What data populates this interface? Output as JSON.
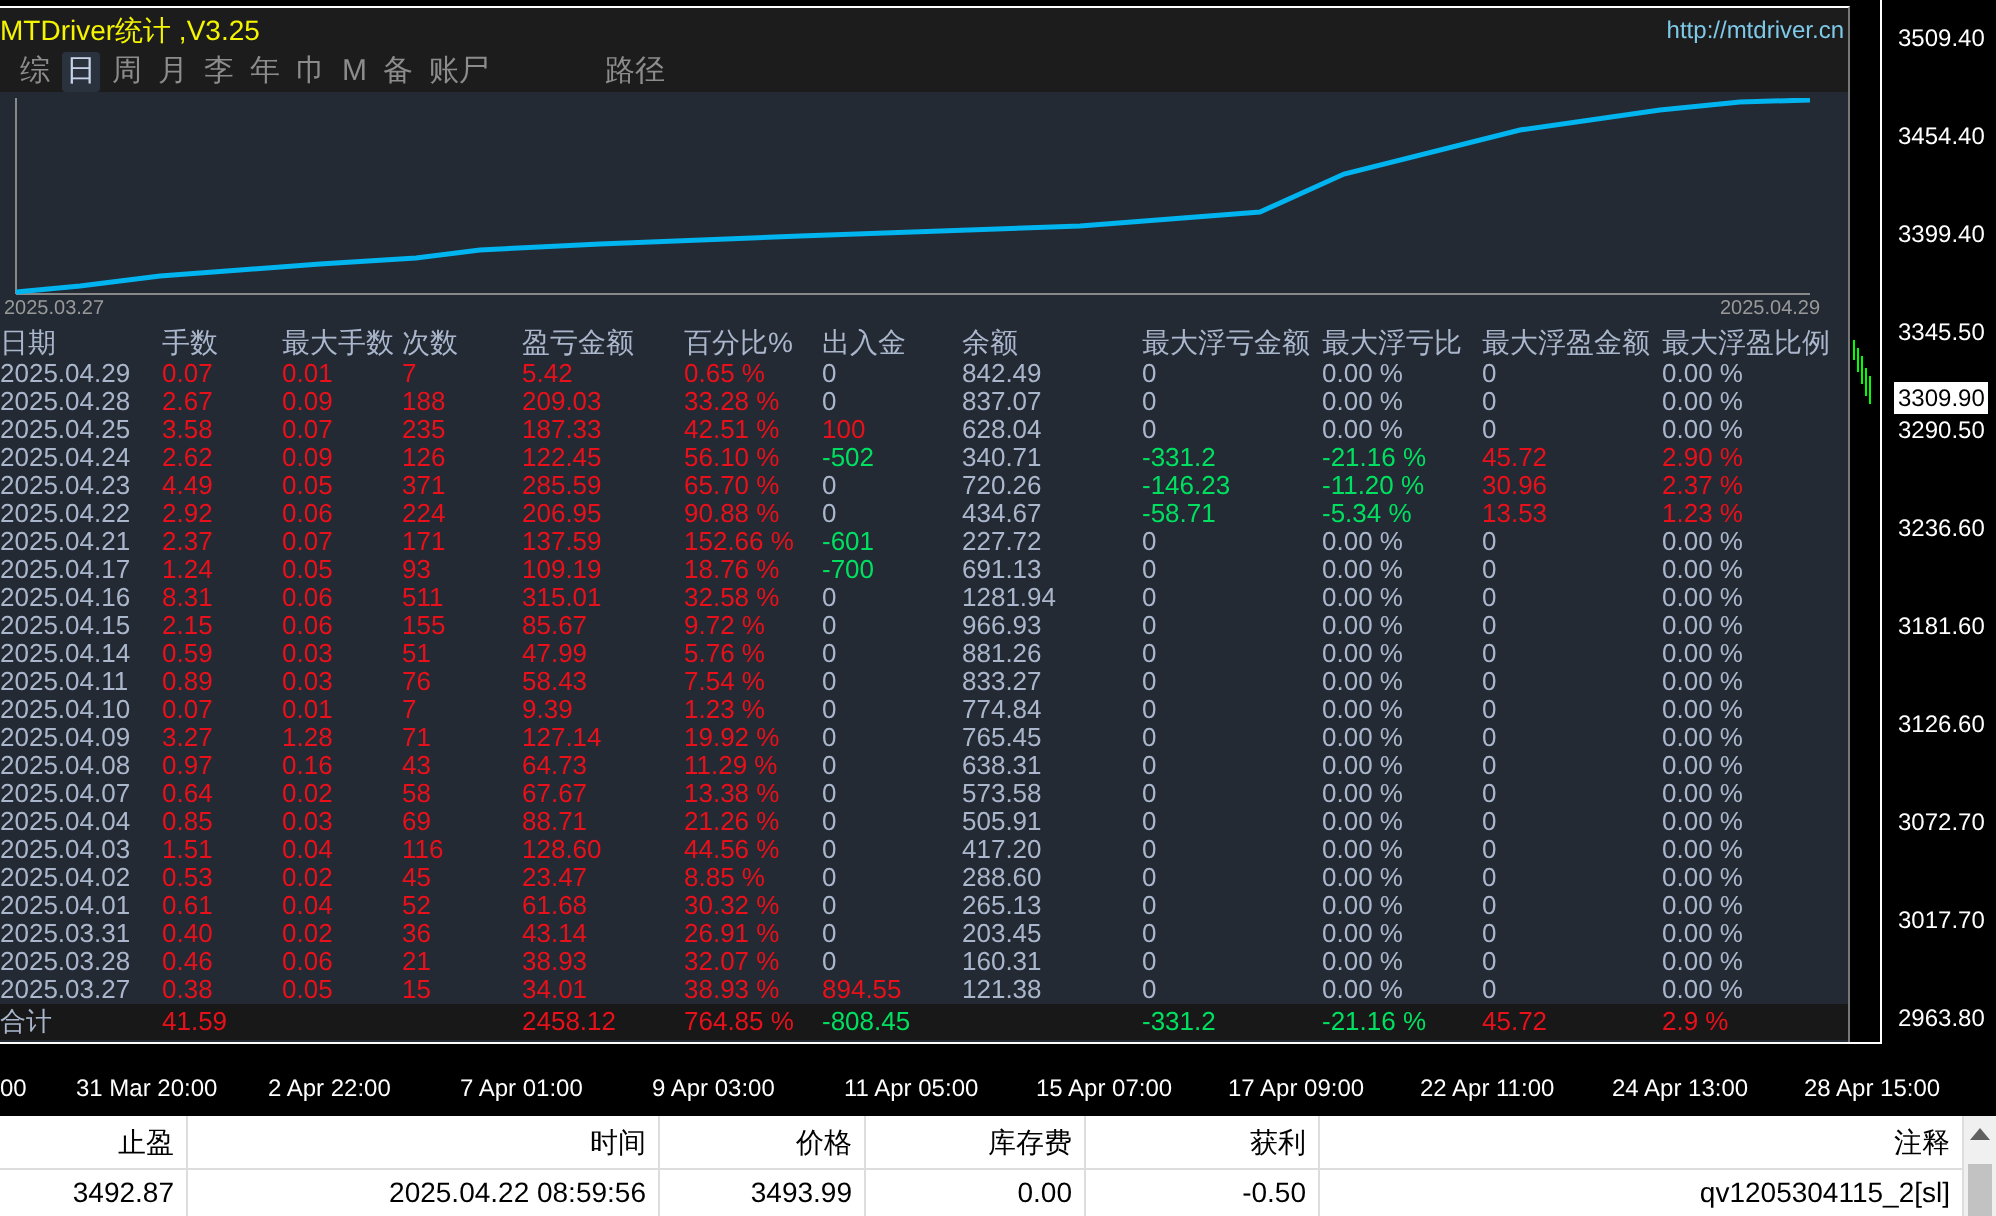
{
  "panel": {
    "title": "MTDriver统计 ,V3.25",
    "url": "http://mtdriver.cn",
    "tabs": [
      {
        "label": "综",
        "selected": false
      },
      {
        "label": "日",
        "selected": true
      },
      {
        "label": "周",
        "selected": false
      },
      {
        "label": "月",
        "selected": false
      },
      {
        "label": "李",
        "selected": false
      },
      {
        "label": "年",
        "selected": false
      },
      {
        "label": "巾",
        "selected": false
      },
      {
        "label": "M",
        "selected": false
      },
      {
        "label": "备",
        "selected": false
      },
      {
        "label": "账尸",
        "selected": false
      }
    ],
    "path_tab": "路径",
    "equity_chart": {
      "start_label": "2025.03.27",
      "end_label": "2025.04.29"
    },
    "table": {
      "columns": [
        "日期",
        "手数",
        "最大手数",
        "次数",
        "盈亏金额",
        "百分比%",
        "出入金",
        "余额",
        "最大浮亏金额",
        "最大浮亏比",
        "最大浮盈金额",
        "最大浮盈比例"
      ],
      "rows": [
        [
          {
            "text": "2025.04.29",
            "color": "#aab6cc"
          },
          {
            "text": "0.07",
            "color": "#e8101a"
          },
          {
            "text": "0.01",
            "color": "#e8101a"
          },
          {
            "text": "7",
            "color": "#e8101a"
          },
          {
            "text": "5.42",
            "color": "#e8101a"
          },
          {
            "text": "0.65 %",
            "color": "#e8101a"
          },
          {
            "text": "0",
            "color": "#aab6cc"
          },
          {
            "text": "842.49",
            "color": "#aab6cc"
          },
          {
            "text": "0",
            "color": "#aab6cc"
          },
          {
            "text": "0.00 %",
            "color": "#aab6cc"
          },
          {
            "text": "0",
            "color": "#aab6cc"
          },
          {
            "text": "0.00 %",
            "color": "#aab6cc"
          }
        ],
        [
          {
            "text": "2025.04.28",
            "color": "#aab6cc"
          },
          {
            "text": "2.67",
            "color": "#e8101a"
          },
          {
            "text": "0.09",
            "color": "#e8101a"
          },
          {
            "text": "188",
            "color": "#e8101a"
          },
          {
            "text": "209.03",
            "color": "#e8101a"
          },
          {
            "text": "33.28 %",
            "color": "#e8101a"
          },
          {
            "text": "0",
            "color": "#aab6cc"
          },
          {
            "text": "837.07",
            "color": "#aab6cc"
          },
          {
            "text": "0",
            "color": "#aab6cc"
          },
          {
            "text": "0.00 %",
            "color": "#aab6cc"
          },
          {
            "text": "0",
            "color": "#aab6cc"
          },
          {
            "text": "0.00 %",
            "color": "#aab6cc"
          }
        ],
        [
          {
            "text": "2025.04.25",
            "color": "#aab6cc"
          },
          {
            "text": "3.58",
            "color": "#e8101a"
          },
          {
            "text": "0.07",
            "color": "#e8101a"
          },
          {
            "text": "235",
            "color": "#e8101a"
          },
          {
            "text": "187.33",
            "color": "#e8101a"
          },
          {
            "text": "42.51 %",
            "color": "#e8101a"
          },
          {
            "text": "100",
            "color": "#e8101a"
          },
          {
            "text": "628.04",
            "color": "#aab6cc"
          },
          {
            "text": "0",
            "color": "#aab6cc"
          },
          {
            "text": "0.00 %",
            "color": "#aab6cc"
          },
          {
            "text": "0",
            "color": "#aab6cc"
          },
          {
            "text": "0.00 %",
            "color": "#aab6cc"
          }
        ],
        [
          {
            "text": "2025.04.24",
            "color": "#aab6cc"
          },
          {
            "text": "2.62",
            "color": "#e8101a"
          },
          {
            "text": "0.09",
            "color": "#e8101a"
          },
          {
            "text": "126",
            "color": "#e8101a"
          },
          {
            "text": "122.45",
            "color": "#e8101a"
          },
          {
            "text": "56.10 %",
            "color": "#e8101a"
          },
          {
            "text": "-502",
            "color": "#00e060"
          },
          {
            "text": "340.71",
            "color": "#aab6cc"
          },
          {
            "text": "-331.2",
            "color": "#00e060"
          },
          {
            "text": "-21.16 %",
            "color": "#00e060"
          },
          {
            "text": "45.72",
            "color": "#e8101a"
          },
          {
            "text": "2.90 %",
            "color": "#e8101a"
          }
        ],
        [
          {
            "text": "2025.04.23",
            "color": "#aab6cc"
          },
          {
            "text": "4.49",
            "color": "#e8101a"
          },
          {
            "text": "0.05",
            "color": "#e8101a"
          },
          {
            "text": "371",
            "color": "#e8101a"
          },
          {
            "text": "285.59",
            "color": "#e8101a"
          },
          {
            "text": "65.70 %",
            "color": "#e8101a"
          },
          {
            "text": "0",
            "color": "#aab6cc"
          },
          {
            "text": "720.26",
            "color": "#aab6cc"
          },
          {
            "text": "-146.23",
            "color": "#00e060"
          },
          {
            "text": "-11.20 %",
            "color": "#00e060"
          },
          {
            "text": "30.96",
            "color": "#e8101a"
          },
          {
            "text": "2.37 %",
            "color": "#e8101a"
          }
        ],
        [
          {
            "text": "2025.04.22",
            "color": "#aab6cc"
          },
          {
            "text": "2.92",
            "color": "#e8101a"
          },
          {
            "text": "0.06",
            "color": "#e8101a"
          },
          {
            "text": "224",
            "color": "#e8101a"
          },
          {
            "text": "206.95",
            "color": "#e8101a"
          },
          {
            "text": "90.88 %",
            "color": "#e8101a"
          },
          {
            "text": "0",
            "color": "#aab6cc"
          },
          {
            "text": "434.67",
            "color": "#aab6cc"
          },
          {
            "text": "-58.71",
            "color": "#00e060"
          },
          {
            "text": "-5.34 %",
            "color": "#00e060"
          },
          {
            "text": "13.53",
            "color": "#e8101a"
          },
          {
            "text": "1.23 %",
            "color": "#e8101a"
          }
        ],
        [
          {
            "text": "2025.04.21",
            "color": "#aab6cc"
          },
          {
            "text": "2.37",
            "color": "#e8101a"
          },
          {
            "text": "0.07",
            "color": "#e8101a"
          },
          {
            "text": "171",
            "color": "#e8101a"
          },
          {
            "text": "137.59",
            "color": "#e8101a"
          },
          {
            "text": "152.66 %",
            "color": "#e8101a"
          },
          {
            "text": "-601",
            "color": "#00e060"
          },
          {
            "text": "227.72",
            "color": "#aab6cc"
          },
          {
            "text": "0",
            "color": "#aab6cc"
          },
          {
            "text": "0.00 %",
            "color": "#aab6cc"
          },
          {
            "text": "0",
            "color": "#aab6cc"
          },
          {
            "text": "0.00 %",
            "color": "#aab6cc"
          }
        ],
        [
          {
            "text": "2025.04.17",
            "color": "#aab6cc"
          },
          {
            "text": "1.24",
            "color": "#e8101a"
          },
          {
            "text": "0.05",
            "color": "#e8101a"
          },
          {
            "text": "93",
            "color": "#e8101a"
          },
          {
            "text": "109.19",
            "color": "#e8101a"
          },
          {
            "text": "18.76 %",
            "color": "#e8101a"
          },
          {
            "text": "-700",
            "color": "#00e060"
          },
          {
            "text": "691.13",
            "color": "#aab6cc"
          },
          {
            "text": "0",
            "color": "#aab6cc"
          },
          {
            "text": "0.00 %",
            "color": "#aab6cc"
          },
          {
            "text": "0",
            "color": "#aab6cc"
          },
          {
            "text": "0.00 %",
            "color": "#aab6cc"
          }
        ],
        [
          {
            "text": "2025.04.16",
            "color": "#aab6cc"
          },
          {
            "text": "8.31",
            "color": "#e8101a"
          },
          {
            "text": "0.06",
            "color": "#e8101a"
          },
          {
            "text": "511",
            "color": "#e8101a"
          },
          {
            "text": "315.01",
            "color": "#e8101a"
          },
          {
            "text": "32.58 %",
            "color": "#e8101a"
          },
          {
            "text": "0",
            "color": "#aab6cc"
          },
          {
            "text": "1281.94",
            "color": "#aab6cc"
          },
          {
            "text": "0",
            "color": "#aab6cc"
          },
          {
            "text": "0.00 %",
            "color": "#aab6cc"
          },
          {
            "text": "0",
            "color": "#aab6cc"
          },
          {
            "text": "0.00 %",
            "color": "#aab6cc"
          }
        ],
        [
          {
            "text": "2025.04.15",
            "color": "#aab6cc"
          },
          {
            "text": "2.15",
            "color": "#e8101a"
          },
          {
            "text": "0.06",
            "color": "#e8101a"
          },
          {
            "text": "155",
            "color": "#e8101a"
          },
          {
            "text": "85.67",
            "color": "#e8101a"
          },
          {
            "text": "9.72 %",
            "color": "#e8101a"
          },
          {
            "text": "0",
            "color": "#aab6cc"
          },
          {
            "text": "966.93",
            "color": "#aab6cc"
          },
          {
            "text": "0",
            "color": "#aab6cc"
          },
          {
            "text": "0.00 %",
            "color": "#aab6cc"
          },
          {
            "text": "0",
            "color": "#aab6cc"
          },
          {
            "text": "0.00 %",
            "color": "#aab6cc"
          }
        ],
        [
          {
            "text": "2025.04.14",
            "color": "#aab6cc"
          },
          {
            "text": "0.59",
            "color": "#e8101a"
          },
          {
            "text": "0.03",
            "color": "#e8101a"
          },
          {
            "text": "51",
            "color": "#e8101a"
          },
          {
            "text": "47.99",
            "color": "#e8101a"
          },
          {
            "text": "5.76 %",
            "color": "#e8101a"
          },
          {
            "text": "0",
            "color": "#aab6cc"
          },
          {
            "text": "881.26",
            "color": "#aab6cc"
          },
          {
            "text": "0",
            "color": "#aab6cc"
          },
          {
            "text": "0.00 %",
            "color": "#aab6cc"
          },
          {
            "text": "0",
            "color": "#aab6cc"
          },
          {
            "text": "0.00 %",
            "color": "#aab6cc"
          }
        ],
        [
          {
            "text": "2025.04.11",
            "color": "#aab6cc"
          },
          {
            "text": "0.89",
            "color": "#e8101a"
          },
          {
            "text": "0.03",
            "color": "#e8101a"
          },
          {
            "text": "76",
            "color": "#e8101a"
          },
          {
            "text": "58.43",
            "color": "#e8101a"
          },
          {
            "text": "7.54 %",
            "color": "#e8101a"
          },
          {
            "text": "0",
            "color": "#aab6cc"
          },
          {
            "text": "833.27",
            "color": "#aab6cc"
          },
          {
            "text": "0",
            "color": "#aab6cc"
          },
          {
            "text": "0.00 %",
            "color": "#aab6cc"
          },
          {
            "text": "0",
            "color": "#aab6cc"
          },
          {
            "text": "0.00 %",
            "color": "#aab6cc"
          }
        ],
        [
          {
            "text": "2025.04.10",
            "color": "#aab6cc"
          },
          {
            "text": "0.07",
            "color": "#e8101a"
          },
          {
            "text": "0.01",
            "color": "#e8101a"
          },
          {
            "text": "7",
            "color": "#e8101a"
          },
          {
            "text": "9.39",
            "color": "#e8101a"
          },
          {
            "text": "1.23 %",
            "color": "#e8101a"
          },
          {
            "text": "0",
            "color": "#aab6cc"
          },
          {
            "text": "774.84",
            "color": "#aab6cc"
          },
          {
            "text": "0",
            "color": "#aab6cc"
          },
          {
            "text": "0.00 %",
            "color": "#aab6cc"
          },
          {
            "text": "0",
            "color": "#aab6cc"
          },
          {
            "text": "0.00 %",
            "color": "#aab6cc"
          }
        ],
        [
          {
            "text": "2025.04.09",
            "color": "#aab6cc"
          },
          {
            "text": "3.27",
            "color": "#e8101a"
          },
          {
            "text": "1.28",
            "color": "#e8101a"
          },
          {
            "text": "71",
            "color": "#e8101a"
          },
          {
            "text": "127.14",
            "color": "#e8101a"
          },
          {
            "text": "19.92 %",
            "color": "#e8101a"
          },
          {
            "text": "0",
            "color": "#aab6cc"
          },
          {
            "text": "765.45",
            "color": "#aab6cc"
          },
          {
            "text": "0",
            "color": "#aab6cc"
          },
          {
            "text": "0.00 %",
            "color": "#aab6cc"
          },
          {
            "text": "0",
            "color": "#aab6cc"
          },
          {
            "text": "0.00 %",
            "color": "#aab6cc"
          }
        ],
        [
          {
            "text": "2025.04.08",
            "color": "#aab6cc"
          },
          {
            "text": "0.97",
            "color": "#e8101a"
          },
          {
            "text": "0.16",
            "color": "#e8101a"
          },
          {
            "text": "43",
            "color": "#e8101a"
          },
          {
            "text": "64.73",
            "color": "#e8101a"
          },
          {
            "text": "11.29 %",
            "color": "#e8101a"
          },
          {
            "text": "0",
            "color": "#aab6cc"
          },
          {
            "text": "638.31",
            "color": "#aab6cc"
          },
          {
            "text": "0",
            "color": "#aab6cc"
          },
          {
            "text": "0.00 %",
            "color": "#aab6cc"
          },
          {
            "text": "0",
            "color": "#aab6cc"
          },
          {
            "text": "0.00 %",
            "color": "#aab6cc"
          }
        ],
        [
          {
            "text": "2025.04.07",
            "color": "#aab6cc"
          },
          {
            "text": "0.64",
            "color": "#e8101a"
          },
          {
            "text": "0.02",
            "color": "#e8101a"
          },
          {
            "text": "58",
            "color": "#e8101a"
          },
          {
            "text": "67.67",
            "color": "#e8101a"
          },
          {
            "text": "13.38 %",
            "color": "#e8101a"
          },
          {
            "text": "0",
            "color": "#aab6cc"
          },
          {
            "text": "573.58",
            "color": "#aab6cc"
          },
          {
            "text": "0",
            "color": "#aab6cc"
          },
          {
            "text": "0.00 %",
            "color": "#aab6cc"
          },
          {
            "text": "0",
            "color": "#aab6cc"
          },
          {
            "text": "0.00 %",
            "color": "#aab6cc"
          }
        ],
        [
          {
            "text": "2025.04.04",
            "color": "#aab6cc"
          },
          {
            "text": "0.85",
            "color": "#e8101a"
          },
          {
            "text": "0.03",
            "color": "#e8101a"
          },
          {
            "text": "69",
            "color": "#e8101a"
          },
          {
            "text": "88.71",
            "color": "#e8101a"
          },
          {
            "text": "21.26 %",
            "color": "#e8101a"
          },
          {
            "text": "0",
            "color": "#aab6cc"
          },
          {
            "text": "505.91",
            "color": "#aab6cc"
          },
          {
            "text": "0",
            "color": "#aab6cc"
          },
          {
            "text": "0.00 %",
            "color": "#aab6cc"
          },
          {
            "text": "0",
            "color": "#aab6cc"
          },
          {
            "text": "0.00 %",
            "color": "#aab6cc"
          }
        ],
        [
          {
            "text": "2025.04.03",
            "color": "#aab6cc"
          },
          {
            "text": "1.51",
            "color": "#e8101a"
          },
          {
            "text": "0.04",
            "color": "#e8101a"
          },
          {
            "text": "116",
            "color": "#e8101a"
          },
          {
            "text": "128.60",
            "color": "#e8101a"
          },
          {
            "text": "44.56 %",
            "color": "#e8101a"
          },
          {
            "text": "0",
            "color": "#aab6cc"
          },
          {
            "text": "417.20",
            "color": "#aab6cc"
          },
          {
            "text": "0",
            "color": "#aab6cc"
          },
          {
            "text": "0.00 %",
            "color": "#aab6cc"
          },
          {
            "text": "0",
            "color": "#aab6cc"
          },
          {
            "text": "0.00 %",
            "color": "#aab6cc"
          }
        ],
        [
          {
            "text": "2025.04.02",
            "color": "#aab6cc"
          },
          {
            "text": "0.53",
            "color": "#e8101a"
          },
          {
            "text": "0.02",
            "color": "#e8101a"
          },
          {
            "text": "45",
            "color": "#e8101a"
          },
          {
            "text": "23.47",
            "color": "#e8101a"
          },
          {
            "text": "8.85 %",
            "color": "#e8101a"
          },
          {
            "text": "0",
            "color": "#aab6cc"
          },
          {
            "text": "288.60",
            "color": "#aab6cc"
          },
          {
            "text": "0",
            "color": "#aab6cc"
          },
          {
            "text": "0.00 %",
            "color": "#aab6cc"
          },
          {
            "text": "0",
            "color": "#aab6cc"
          },
          {
            "text": "0.00 %",
            "color": "#aab6cc"
          }
        ],
        [
          {
            "text": "2025.04.01",
            "color": "#aab6cc"
          },
          {
            "text": "0.61",
            "color": "#e8101a"
          },
          {
            "text": "0.04",
            "color": "#e8101a"
          },
          {
            "text": "52",
            "color": "#e8101a"
          },
          {
            "text": "61.68",
            "color": "#e8101a"
          },
          {
            "text": "30.32 %",
            "color": "#e8101a"
          },
          {
            "text": "0",
            "color": "#aab6cc"
          },
          {
            "text": "265.13",
            "color": "#aab6cc"
          },
          {
            "text": "0",
            "color": "#aab6cc"
          },
          {
            "text": "0.00 %",
            "color": "#aab6cc"
          },
          {
            "text": "0",
            "color": "#aab6cc"
          },
          {
            "text": "0.00 %",
            "color": "#aab6cc"
          }
        ],
        [
          {
            "text": "2025.03.31",
            "color": "#aab6cc"
          },
          {
            "text": "0.40",
            "color": "#e8101a"
          },
          {
            "text": "0.02",
            "color": "#e8101a"
          },
          {
            "text": "36",
            "color": "#e8101a"
          },
          {
            "text": "43.14",
            "color": "#e8101a"
          },
          {
            "text": "26.91 %",
            "color": "#e8101a"
          },
          {
            "text": "0",
            "color": "#aab6cc"
          },
          {
            "text": "203.45",
            "color": "#aab6cc"
          },
          {
            "text": "0",
            "color": "#aab6cc"
          },
          {
            "text": "0.00 %",
            "color": "#aab6cc"
          },
          {
            "text": "0",
            "color": "#aab6cc"
          },
          {
            "text": "0.00 %",
            "color": "#aab6cc"
          }
        ],
        [
          {
            "text": "2025.03.28",
            "color": "#aab6cc"
          },
          {
            "text": "0.46",
            "color": "#e8101a"
          },
          {
            "text": "0.06",
            "color": "#e8101a"
          },
          {
            "text": "21",
            "color": "#e8101a"
          },
          {
            "text": "38.93",
            "color": "#e8101a"
          },
          {
            "text": "32.07 %",
            "color": "#e8101a"
          },
          {
            "text": "0",
            "color": "#aab6cc"
          },
          {
            "text": "160.31",
            "color": "#aab6cc"
          },
          {
            "text": "0",
            "color": "#aab6cc"
          },
          {
            "text": "0.00 %",
            "color": "#aab6cc"
          },
          {
            "text": "0",
            "color": "#aab6cc"
          },
          {
            "text": "0.00 %",
            "color": "#aab6cc"
          }
        ],
        [
          {
            "text": "2025.03.27",
            "color": "#aab6cc"
          },
          {
            "text": "0.38",
            "color": "#e8101a"
          },
          {
            "text": "0.05",
            "color": "#e8101a"
          },
          {
            "text": "15",
            "color": "#e8101a"
          },
          {
            "text": "34.01",
            "color": "#e8101a"
          },
          {
            "text": "38.93 %",
            "color": "#e8101a"
          },
          {
            "text": "894.55",
            "color": "#e8101a"
          },
          {
            "text": "121.38",
            "color": "#aab6cc"
          },
          {
            "text": "0",
            "color": "#aab6cc"
          },
          {
            "text": "0.00 %",
            "color": "#aab6cc"
          },
          {
            "text": "0",
            "color": "#aab6cc"
          },
          {
            "text": "0.00 %",
            "color": "#aab6cc"
          }
        ]
      ],
      "total": {
        "label": {
          "text": "合计",
          "color": "#aab6cc"
        },
        "lots": {
          "text": "41.59",
          "color": "#e8101a"
        },
        "profit": {
          "text": "2458.12",
          "color": "#e8101a"
        },
        "percent": {
          "text": "764.85 %",
          "color": "#e8101a"
        },
        "deposit": {
          "text": "-808.45",
          "color": "#00e060"
        },
        "max_float_loss": {
          "text": "-331.2",
          "color": "#00e060"
        },
        "max_float_loss_pct": {
          "text": "-21.16 %",
          "color": "#00e060"
        },
        "max_float_profit": {
          "text": "45.72",
          "color": "#e8101a"
        },
        "max_float_profit_pct": {
          "text": "2.9 %",
          "color": "#e8101a"
        }
      }
    }
  },
  "price_axis": [
    {
      "label": "3509.40",
      "current": false
    },
    {
      "label": "3454.40",
      "current": false
    },
    {
      "label": "3399.40",
      "current": false
    },
    {
      "label": "3345.50",
      "current": false
    },
    {
      "label": "3309.90",
      "current": true
    },
    {
      "label": "3290.50",
      "current": false
    },
    {
      "label": "3236.60",
      "current": false
    },
    {
      "label": "3181.60",
      "current": false
    },
    {
      "label": "3126.60",
      "current": false
    },
    {
      "label": "3072.70",
      "current": false
    },
    {
      "label": "3017.70",
      "current": false
    },
    {
      "label": "2963.80",
      "current": false
    }
  ],
  "time_axis": [
    "00",
    "31 Mar 20:00",
    "2 Apr 22:00",
    "7 Apr 01:00",
    "9 Apr 03:00",
    "11 Apr 05:00",
    "15 Apr 07:00",
    "17 Apr 09:00",
    "22 Apr 11:00",
    "24 Apr 13:00",
    "28 Apr 15:00"
  ],
  "orders": {
    "columns": [
      "止盈",
      "时间",
      "价格",
      "库存费",
      "获利",
      "注释"
    ],
    "rows": [
      [
        "3492.87",
        "2025.04.22 08:59:56",
        "3493.99",
        "0.00",
        "-0.50",
        "qv1205304115_2[sl]"
      ]
    ]
  }
}
